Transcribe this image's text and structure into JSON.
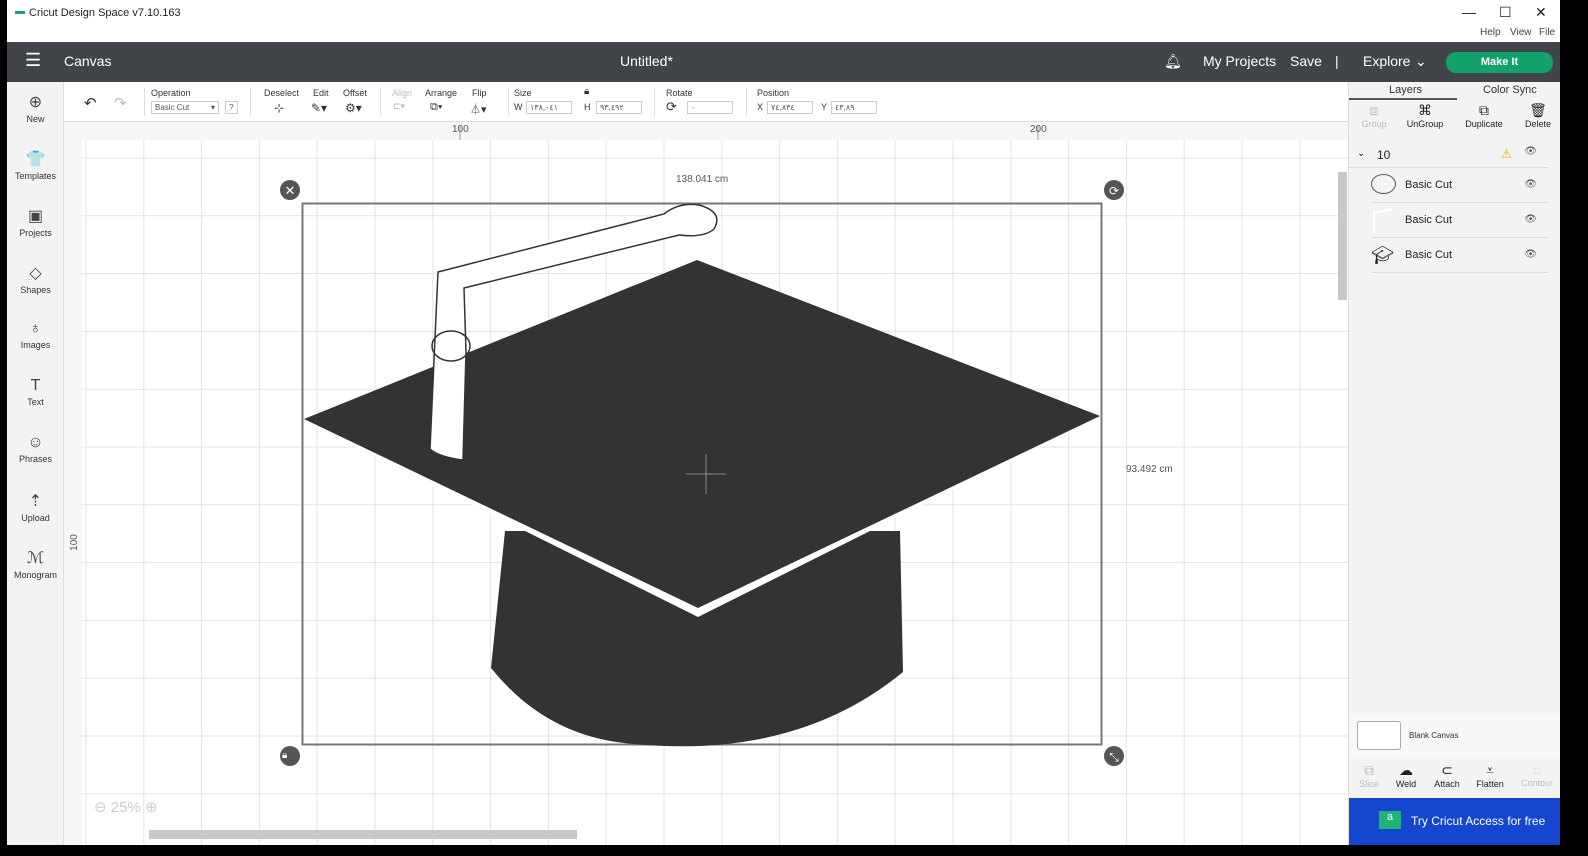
{
  "window": {
    "title": "Cricut Design Space  v7.10.163",
    "controls": [
      "—",
      "☐",
      "✕"
    ],
    "menu": [
      "Help",
      "View",
      "File"
    ]
  },
  "header": {
    "section": "Canvas",
    "doc_title": "Untitled*",
    "my_projects": "My Projects",
    "save": "Save",
    "divider": "|",
    "explore": "Explore",
    "make_it": "Make It"
  },
  "sidebar": [
    {
      "icon": "plus-circle-icon",
      "glyph": "⊕",
      "label": "New"
    },
    {
      "icon": "shirt-icon",
      "glyph": "👕",
      "label": "Templates"
    },
    {
      "icon": "projects-icon",
      "glyph": "▣",
      "label": "Projects"
    },
    {
      "icon": "shapes-icon",
      "glyph": "◇",
      "label": "Shapes"
    },
    {
      "icon": "lightbulb-icon",
      "glyph": "♁",
      "label": "Images"
    },
    {
      "icon": "text-icon",
      "glyph": "T",
      "label": "Text"
    },
    {
      "icon": "chat-icon",
      "glyph": "☺",
      "label": "Phrases"
    },
    {
      "icon": "upload-icon",
      "glyph": "⇡",
      "label": "Upload"
    },
    {
      "icon": "monogram-icon",
      "glyph": "ℳ",
      "label": "Monogram"
    }
  ],
  "toolbar": {
    "operation_label": "Operation",
    "operation_value": "Basic Cut",
    "help": "?",
    "deselect": "Deselect",
    "edit": "Edit",
    "offset": "Offset",
    "align": "Align",
    "arrange": "Arrange",
    "flip": "Flip",
    "size": "Size",
    "w_label": "W",
    "w": "١٣٨,٠٤١",
    "h_label": "H",
    "h": "٩٣,٤٩٢",
    "rotate": "Rotate",
    "rotate_value": "٠",
    "position": "Position",
    "x_label": "X",
    "x": "٧٤,٨٣٤",
    "y_label": "Y",
    "y": "٤٣,٨٩"
  },
  "canvas": {
    "ruler_top": [
      "100",
      "200"
    ],
    "ruler_left": [
      "100"
    ],
    "width_label": "138.041 cm",
    "height_label": "93.492 cm",
    "zoom": "25%"
  },
  "right": {
    "tabs": [
      "Layers",
      "Color Sync"
    ],
    "actions": [
      "Group",
      "UnGroup",
      "Duplicate",
      "Delete"
    ],
    "group_name": "10",
    "layers": [
      "Basic Cut",
      "Basic Cut",
      "Basic Cut"
    ],
    "blank_canvas": "Blank Canvas",
    "bottom_actions": [
      "Slice",
      "Weld",
      "Attach",
      "Flatten",
      "Contour"
    ],
    "access": "Try Cricut Access for free"
  },
  "colors": {
    "header": "#414549",
    "make_it": "#12a36c",
    "access": "#1446d0",
    "shape": "#333333"
  }
}
